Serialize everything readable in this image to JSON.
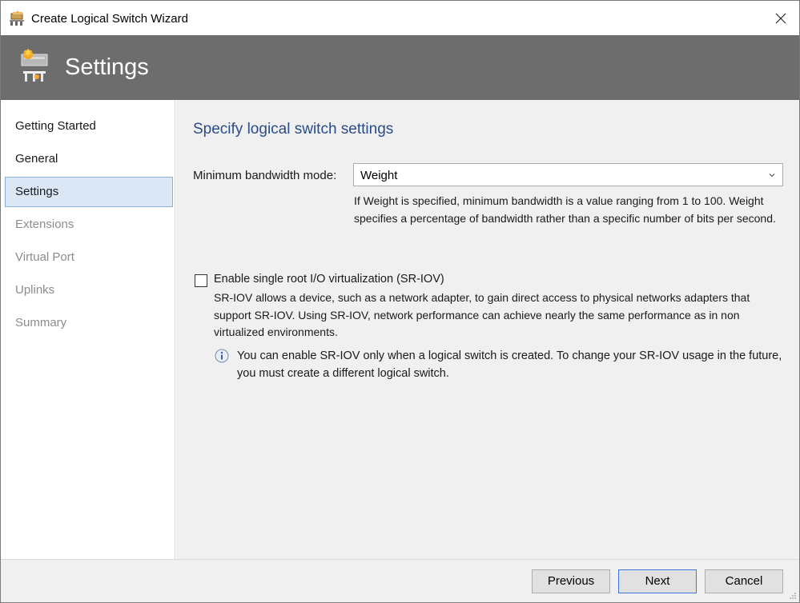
{
  "window": {
    "title": "Create Logical Switch Wizard",
    "close_icon": "close-icon",
    "app_icon": "logical-switch-icon"
  },
  "banner": {
    "title": "Settings",
    "icon": "logical-switch-settings-icon",
    "background_color": "#6d6d6d"
  },
  "sidebar": {
    "items": [
      {
        "label": "Getting Started",
        "state": "enabled"
      },
      {
        "label": "General",
        "state": "enabled"
      },
      {
        "label": "Settings",
        "state": "selected"
      },
      {
        "label": "Extensions",
        "state": "disabled"
      },
      {
        "label": "Virtual Port",
        "state": "disabled"
      },
      {
        "label": "Uplinks",
        "state": "disabled"
      },
      {
        "label": "Summary",
        "state": "disabled"
      }
    ]
  },
  "main": {
    "heading": "Specify logical switch settings",
    "bandwidth": {
      "label": "Minimum bandwidth mode:",
      "selected": "Weight",
      "help": "If Weight is specified, minimum bandwidth is a value ranging from 1 to 100. Weight specifies a percentage of bandwidth rather than a specific number of bits per second."
    },
    "sriov": {
      "label": "Enable single root I/O virtualization (SR-IOV)",
      "checked": false,
      "description": "SR-IOV allows a device, such as a network adapter, to gain direct access to physical networks adapters that support SR-IOV. Using SR-IOV, network performance can achieve nearly the same performance as in non virtualized environments.",
      "info": "You can enable SR-IOV only when a logical switch is created. To change your SR-IOV usage in the future, you must create a different logical switch."
    }
  },
  "footer": {
    "previous_label": "Previous",
    "next_label": "Next",
    "cancel_label": "Cancel"
  },
  "colors": {
    "heading": "#2a4c8c",
    "selected_nav_bg": "#dbe7f5",
    "selected_nav_border": "#8ab0dc",
    "disabled_text": "#8c8c8c"
  }
}
